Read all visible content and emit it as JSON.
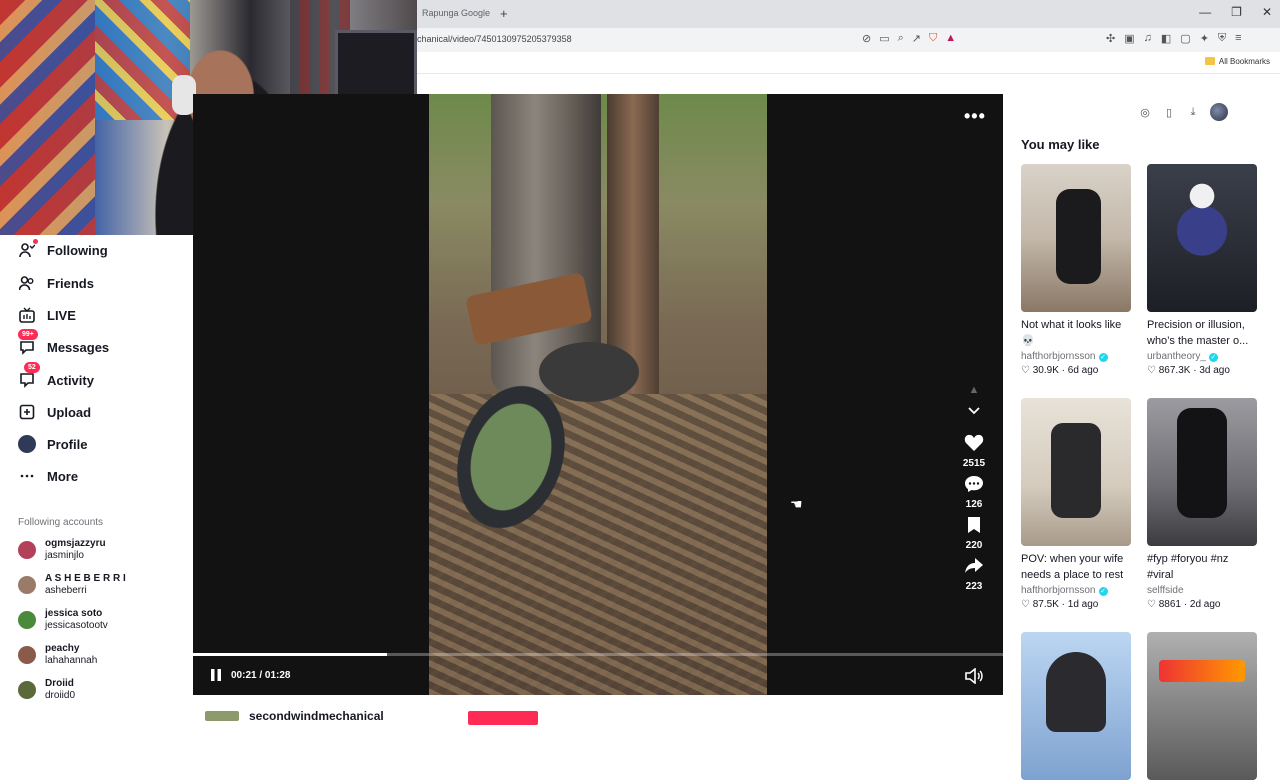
{
  "browser": {
    "tab_title": "Rapunga Google",
    "new_tab": "+",
    "url": "echanical/video/7450130975205379358",
    "bookmarks_label": "All Bookmarks"
  },
  "sidebar": {
    "items": [
      {
        "label": "Following",
        "icon": "following-icon"
      },
      {
        "label": "Friends",
        "icon": "friends-icon"
      },
      {
        "label": "LIVE",
        "icon": "live-icon"
      },
      {
        "label": "Messages",
        "icon": "messages-icon",
        "badge": "99+"
      },
      {
        "label": "Activity",
        "icon": "activity-icon",
        "badge": "52"
      },
      {
        "label": "Upload",
        "icon": "upload-icon"
      },
      {
        "label": "Profile",
        "icon": "profile-icon"
      },
      {
        "label": "More",
        "icon": "more-icon"
      }
    ],
    "following_title": "Following accounts",
    "accounts": [
      {
        "name": "ogmsjazzyru",
        "handle": "jasminjlo",
        "color": "#b3415a"
      },
      {
        "name": "A S H E B E R R I",
        "handle": "asheberri",
        "color": "#9a7b6a"
      },
      {
        "name": "jessica soto",
        "handle": "jessicasotootv",
        "color": "#4a8a3a"
      },
      {
        "name": "peachy",
        "handle": "lahahannah",
        "color": "#8a5a4a"
      },
      {
        "name": "Droiid",
        "handle": "droiid0",
        "color": "#5a6a3a"
      }
    ]
  },
  "player": {
    "more": "•••",
    "likes": "2515",
    "comments": "126",
    "saves": "220",
    "shares": "223",
    "time": "00:21 / 01:28",
    "progress": 0.24
  },
  "below": {
    "username": "secondwindmechanical"
  },
  "right": {
    "title": "You may like",
    "cards": [
      {
        "caption": "Not what it looks like 💀",
        "author": "hafthorbjornsson",
        "verified": true,
        "likes": "30.9K",
        "age": "6d ago"
      },
      {
        "caption": "Precision or illusion, who’s the master o...",
        "author": "urbantheory_",
        "verified": true,
        "likes": "867.3K",
        "age": "3d ago"
      },
      {
        "caption": "POV: when your wife needs a place to rest",
        "author": "hafthorbjornsson",
        "verified": true,
        "likes": "87.5K",
        "age": "1d ago"
      },
      {
        "caption": "#fyp #foryou #nz #viral",
        "author": "selffside",
        "verified": false,
        "likes": "8861",
        "age": "2d ago"
      },
      {
        "caption": "",
        "author": "",
        "verified": false,
        "likes": "",
        "age": ""
      },
      {
        "caption": "",
        "author": "",
        "verified": false,
        "likes": "",
        "age": ""
      }
    ]
  }
}
